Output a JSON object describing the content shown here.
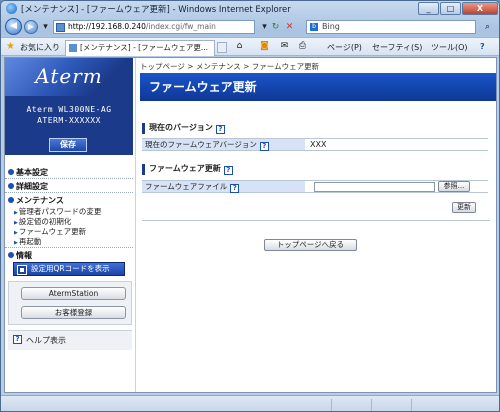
{
  "window": {
    "title": "[メンテナンス] - [ファームウェア更新] - Windows Internet Explorer",
    "minimize": "_",
    "maximize": "□",
    "close": "X"
  },
  "toolbar": {
    "address_host": "http://192.168.0.240",
    "address_path": "/index.cgi/fw_main",
    "search_engine": "Bing",
    "favorites_label": "お気に入り",
    "tab_title": "[メンテナンス] - [ファームウェア更...",
    "page_menu": "ページ(P)",
    "safety_menu": "セーフティ(S)",
    "tools_menu": "ツール(O)",
    "help_symbol": "?"
  },
  "sidebar": {
    "logo": "Aterm",
    "model": "Aterm WL300NE-AG",
    "device_id": "ATERM-XXXXXX",
    "save_button": "保存",
    "menu": {
      "basic": "基本設定",
      "advanced": "詳細設定",
      "maintenance": "メンテナンス",
      "maintenance_items": [
        "管理者パスワードの変更",
        "設定値の初期化",
        "ファームウェア更新",
        "再起動"
      ],
      "info": "情報"
    },
    "qr_button": "設定用QRコードを表示",
    "aterm_station_button": "AtermStation",
    "customer_reg_button": "お客様登録",
    "help_display": "ヘルプ表示"
  },
  "main": {
    "breadcrumb": "トップページ > メンテナンス > ファームウェア更新",
    "page_title": "ファームウェア更新",
    "current_version": {
      "section_title": "現在のバージョン",
      "label": "現在のファームウェアバージョン",
      "value": "XXX"
    },
    "firmware_update": {
      "section_title": "ファームウェア更新",
      "file_label": "ファームウェアファイル",
      "browse_button": "参照...",
      "update_button": "更新"
    },
    "back_to_top_button": "トップページへ戻る",
    "help_symbol": "?"
  }
}
